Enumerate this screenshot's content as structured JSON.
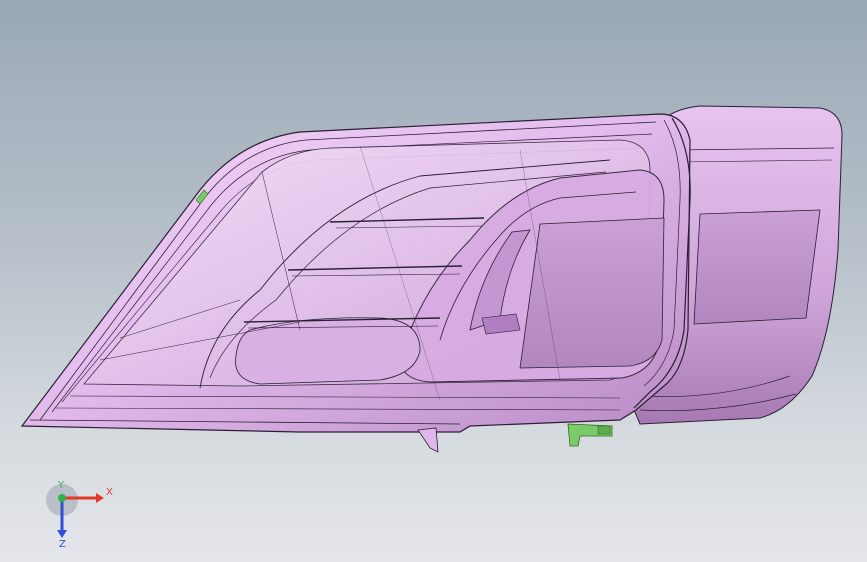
{
  "viewport": {
    "model": "headlamp-assembly",
    "render_mode": "shaded-with-edges",
    "colors": {
      "background_top": "#9aa8b6",
      "background_bottom": "#e4e6ea",
      "body": "#e2b9ec",
      "body_shadow": "#b889c6",
      "edge": "#2a1f33",
      "bracket": "#7ccb6a"
    }
  },
  "triad": {
    "x_label": "X",
    "y_label": "Y",
    "z_label": "Z",
    "x_color": "#e23a2a",
    "y_color": "#2fb34a",
    "z_color": "#2e4fd8"
  }
}
